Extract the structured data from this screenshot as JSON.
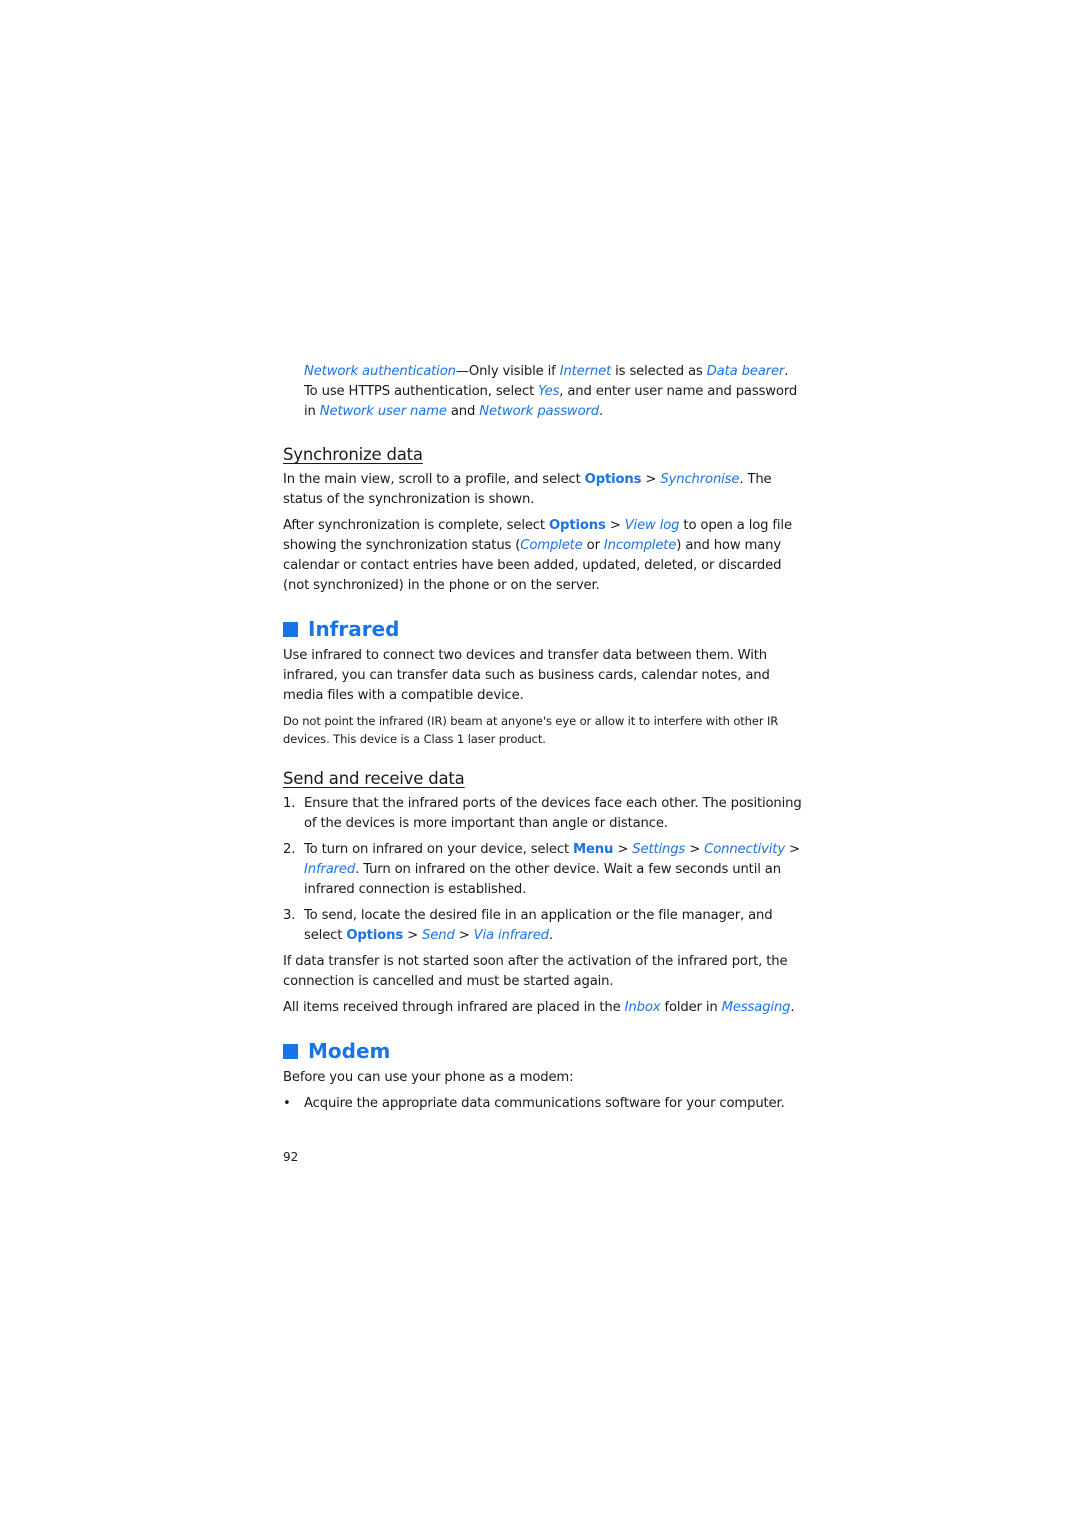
{
  "network_auth": [
    {
      "t": "Network authentication",
      "s": "i"
    },
    {
      "t": "—Only visible if ",
      "s": ""
    },
    {
      "t": "Internet",
      "s": "i"
    },
    {
      "t": " is selected as ",
      "s": ""
    },
    {
      "t": "Data bearer",
      "s": "i"
    },
    {
      "t": ". To use HTTPS authentication, select ",
      "s": ""
    },
    {
      "t": "Yes",
      "s": "i"
    },
    {
      "t": ", and enter user name and password in ",
      "s": ""
    },
    {
      "t": "Network user name",
      "s": "i"
    },
    {
      "t": " and ",
      "s": ""
    },
    {
      "t": "Network password",
      "s": "i"
    },
    {
      "t": ".",
      "s": ""
    }
  ],
  "sync": {
    "heading": "Synchronize data",
    "p1": [
      {
        "t": "In the main view, scroll to a profile, and select ",
        "s": ""
      },
      {
        "t": "Options",
        "s": "b"
      },
      {
        "t": " > ",
        "s": ""
      },
      {
        "t": "Synchronise",
        "s": "i"
      },
      {
        "t": ". The status of the synchronization is shown.",
        "s": ""
      }
    ],
    "p2": [
      {
        "t": "After synchronization is complete, select ",
        "s": ""
      },
      {
        "t": "Options",
        "s": "b"
      },
      {
        "t": " > ",
        "s": ""
      },
      {
        "t": "View log",
        "s": "i"
      },
      {
        "t": " to open a log file showing the synchronization status (",
        "s": ""
      },
      {
        "t": "Complete",
        "s": "i"
      },
      {
        "t": " or ",
        "s": ""
      },
      {
        "t": "Incomplete",
        "s": "i"
      },
      {
        "t": ") and how many calendar or contact entries have been added, updated, deleted, or discarded (not synchronized) in the phone or on the server.",
        "s": ""
      }
    ]
  },
  "infrared": {
    "heading": "Infrared",
    "intro": "Use infrared to connect two devices and transfer data between them. With infrared, you can transfer data such as business cards, calendar notes, and media files with a compatible device.",
    "note": "Do not point the infrared (IR) beam at anyone's eye or allow it to interfere with other IR devices. This device is a Class 1 laser product.",
    "send_heading": "Send and receive data",
    "steps": [
      {
        "num": "1.",
        "runs": [
          {
            "t": "Ensure that the infrared ports of the devices face each other. The positioning of the devices is more important than angle or distance.",
            "s": ""
          }
        ]
      },
      {
        "num": "2.",
        "runs": [
          {
            "t": "To turn on infrared on your device, select ",
            "s": ""
          },
          {
            "t": "Menu",
            "s": "b"
          },
          {
            "t": " > ",
            "s": ""
          },
          {
            "t": "Settings",
            "s": "i"
          },
          {
            "t": " > ",
            "s": ""
          },
          {
            "t": "Connectivity",
            "s": "i"
          },
          {
            "t": " > ",
            "s": ""
          },
          {
            "t": "Infrared",
            "s": "i"
          },
          {
            "t": ". Turn on infrared on the other device. Wait a few seconds until an infrared connection is established.",
            "s": ""
          }
        ]
      },
      {
        "num": "3.",
        "runs": [
          {
            "t": "To send, locate the desired file in an application or the file manager, and select ",
            "s": ""
          },
          {
            "t": "Options",
            "s": "b"
          },
          {
            "t": " > ",
            "s": ""
          },
          {
            "t": "Send",
            "s": "i"
          },
          {
            "t": " > ",
            "s": ""
          },
          {
            "t": "Via infrared",
            "s": "i"
          },
          {
            "t": ".",
            "s": ""
          }
        ]
      }
    ],
    "p_cancel": "If data transfer is not started soon after the activation of the infrared port, the connection is cancelled and must be started again.",
    "p_inbox": [
      {
        "t": "All items received through infrared are placed in the ",
        "s": ""
      },
      {
        "t": "Inbox",
        "s": "i"
      },
      {
        "t": " folder in ",
        "s": ""
      },
      {
        "t": "Messaging",
        "s": "i"
      },
      {
        "t": ".",
        "s": ""
      }
    ]
  },
  "modem": {
    "heading": "Modem",
    "intro": "Before you can use your phone as a modem:",
    "bullets": [
      "Acquire the appropriate data communications software for your computer."
    ]
  },
  "page_number": "92",
  "colors": {
    "accent": "#1a73e8",
    "text": "#1a1a1a"
  }
}
